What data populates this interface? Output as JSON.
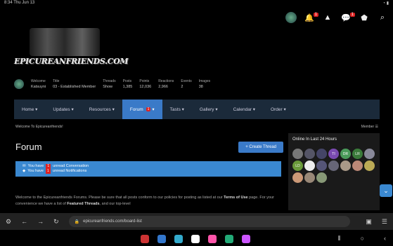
{
  "status": {
    "time": "8:34",
    "date": "Thu Jun 13",
    "wifi": "wifi-icon"
  },
  "topbar": {
    "alerts_count": "1",
    "conversations_count": "1"
  },
  "logo": {
    "text": "EPICUREANFRIENDS.COM"
  },
  "stats": [
    {
      "label": "Welcome",
      "value": "Katsuyni"
    },
    {
      "label": "Title",
      "value": "03 - Established Member"
    },
    {
      "label": "Threads",
      "value": "Show"
    },
    {
      "label": "Posts",
      "value": "1,385"
    },
    {
      "label": "Points",
      "value": "12,036"
    },
    {
      "label": "Reactions",
      "value": "2,966"
    },
    {
      "label": "Events",
      "value": "2"
    },
    {
      "label": "Images",
      "value": "38"
    }
  ],
  "nav": {
    "home": "Home ▾",
    "updates": "Updates ▾",
    "resources": "Resources ▾",
    "forum": "Forum",
    "forum_badge": "1",
    "forum_caret": "▾",
    "tasts": "Tasts ▾",
    "gallery": "Gallery ▾",
    "calendar": "Calendar ▾",
    "order": "Order ▾"
  },
  "crumb": {
    "text": "Welcome To Epicureanfriends!",
    "right": "Member ☰"
  },
  "main": {
    "title": "Forum",
    "create_btn": "+ Create Thread",
    "notice1_pre": "You have",
    "notice1_num": "1",
    "notice1_post": "unread Conversation",
    "notice2_pre": "You have",
    "notice2_num": "1",
    "notice2_post": "unread Notifications",
    "welcome_a": "Welcome to the Epicureanfriends Forums. Please be sure that all posts conform to our policies for posting as listed at our ",
    "welcome_b": "Terms of Use",
    "welcome_c": " page. For your convenience we have a list of ",
    "welcome_d": "Featured Threads",
    "welcome_e": ", and our top-level"
  },
  "sidebar": {
    "title": "Online In Last 24 Hours",
    "avatars": [
      {
        "t": "",
        "c": "#777"
      },
      {
        "t": "",
        "c": "#556"
      },
      {
        "t": "",
        "c": "#446"
      },
      {
        "t": "TI",
        "c": "#7a4ab0"
      },
      {
        "t": "DR",
        "c": "#4a9a5a"
      },
      {
        "t": "LR",
        "c": "#3a7a3a"
      },
      {
        "t": "",
        "c": "#889"
      },
      {
        "t": "LD",
        "c": "#6a9a3a"
      },
      {
        "t": "",
        "c": "#eee"
      },
      {
        "t": "",
        "c": "#557"
      },
      {
        "t": "",
        "c": "#667"
      },
      {
        "t": "",
        "c": "#a98"
      },
      {
        "t": "",
        "c": "#b87"
      },
      {
        "t": "",
        "c": "#ba5"
      },
      {
        "t": "",
        "c": "#c97"
      },
      {
        "t": "",
        "c": "#987"
      },
      {
        "t": "",
        "c": "#897"
      }
    ]
  },
  "browser": {
    "url": "epicureanfriends.com/board-list"
  },
  "taskbar_apps": [
    "#c33",
    "#37c",
    "#3ac",
    "#fff",
    "#f5a",
    "#2a7",
    "#c5f"
  ]
}
